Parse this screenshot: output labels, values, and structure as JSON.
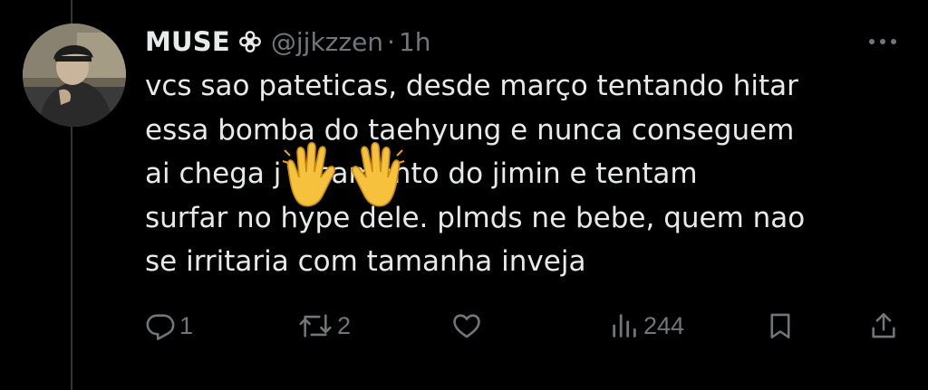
{
  "tweet": {
    "display_name": "MUSE",
    "name_badge_icon": "flower-icon",
    "handle": "@jjkzzen",
    "separator": "·",
    "time": "1h",
    "text_lines": [
      "vcs sao pateticas, desde março tentando hitar",
      "essa bomba do taehyung e nunca conseguem",
      "ai chega j           ınçamento do jimin e tentam",
      "surfar no hype dele. plmds ne bebe, quem nao",
      "se irritaria com tamanha inveja"
    ],
    "overlay_emoji": "raised-hands-emoji"
  },
  "actions": {
    "reply": {
      "icon": "reply-icon",
      "count": "1"
    },
    "retweet": {
      "icon": "retweet-icon",
      "count": "2"
    },
    "like": {
      "icon": "heart-icon",
      "count": ""
    },
    "views": {
      "icon": "views-icon",
      "count": "244"
    },
    "bookmark": {
      "icon": "bookmark-icon"
    },
    "share": {
      "icon": "share-icon"
    }
  },
  "colors": {
    "background": "#000000",
    "text": "#e7e9ea",
    "muted": "#71767b",
    "thread_line": "#333639",
    "emoji": "#f6c23e"
  }
}
